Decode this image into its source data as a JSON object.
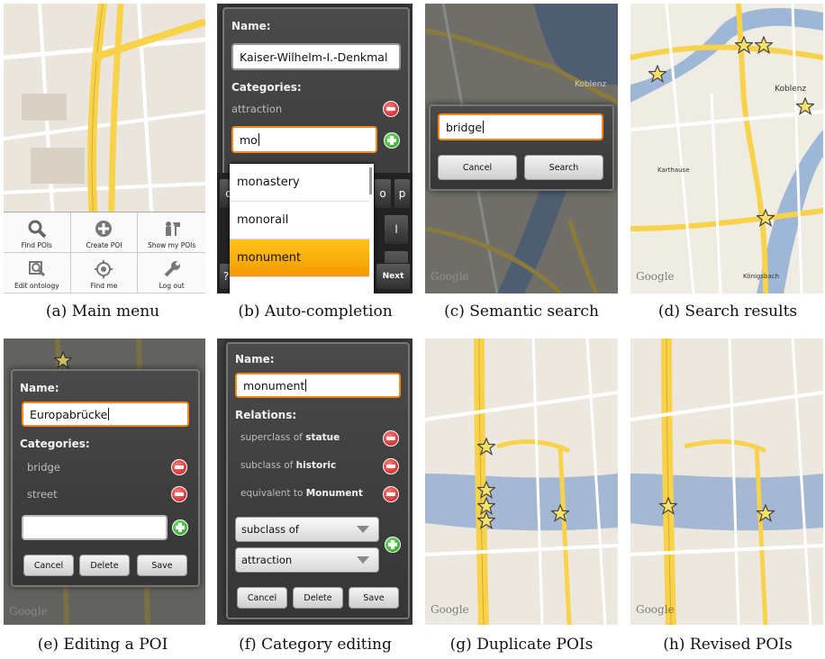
{
  "captions": {
    "a": "(a) Main menu",
    "b": "(b) Auto-completion",
    "c": "(c) Semantic search",
    "d": "(d) Search results",
    "e": "(e) Editing a POI",
    "f": "(f) Category editing",
    "g": "(g) Duplicate POIs",
    "h": "(h) Revised POIs"
  },
  "panel_a": {
    "menu": [
      {
        "label": "Find POIs",
        "icon": "search-icon"
      },
      {
        "label": "Create POI",
        "icon": "add-circle-icon"
      },
      {
        "label": "Show my POIs",
        "icon": "people-icon"
      },
      {
        "label": "Edit ontology",
        "icon": "edit-search-icon"
      },
      {
        "label": "Find me",
        "icon": "locate-icon"
      },
      {
        "label": "Log out",
        "icon": "wrench-icon"
      }
    ]
  },
  "panel_b": {
    "name_label": "Name:",
    "name_value": "Kaiser-Wilhelm-I.-Denkmal",
    "categories_label": "Categories:",
    "category": "attraction",
    "input_value": "mo",
    "suggestions": [
      "monastery",
      "monorail",
      "monument"
    ],
    "keys_visible": [
      "q",
      "o",
      "p",
      "l",
      "DEL",
      "Next",
      "?"
    ]
  },
  "panel_c": {
    "search_value": "bridge",
    "cancel": "Cancel",
    "search": "Search",
    "map_label": "Koblenz"
  },
  "panel_d": {
    "map_labels": [
      "Koblenz",
      "Karthause",
      "Königsbach"
    ]
  },
  "panel_e": {
    "name_label": "Name:",
    "name_value": "Europabrücke",
    "categories_label": "Categories:",
    "categories": [
      "bridge",
      "street"
    ],
    "cancel": "Cancel",
    "delete": "Delete",
    "save": "Save"
  },
  "panel_f": {
    "name_label": "Name:",
    "name_value": "monument",
    "relations_label": "Relations:",
    "relations": [
      {
        "prefix": "superclass of",
        "target": "statue"
      },
      {
        "prefix": "subclass of",
        "target": "historic"
      },
      {
        "prefix": "equivalent to",
        "target": "Monument"
      }
    ],
    "relation_select": "subclass of",
    "target_select": "attraction",
    "cancel": "Cancel",
    "delete": "Delete",
    "save": "Save"
  },
  "google_logo": "Google",
  "colors": {
    "accent": "#f08b1b",
    "road_yellow": "#f7d24a",
    "river": "#9fb7d6",
    "map_bg": "#e9e5dc"
  }
}
